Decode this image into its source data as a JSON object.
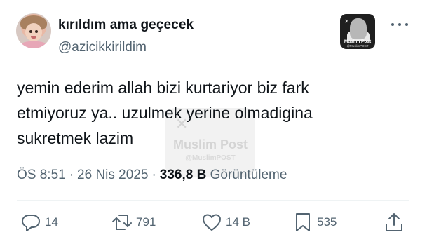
{
  "author": {
    "display_name": "kırıldım ama geçecek",
    "handle": "@azicikkirildim"
  },
  "badge": {
    "title": "Muslim Post",
    "subtitle": "@MuslimPOST"
  },
  "watermark": {
    "title": "Muslim Post",
    "subtitle": "@MuslimPOST"
  },
  "tweet": {
    "lines": [
      "yemin ederim allah bizi kurtariyor biz fark",
      "etmiyoruz ya.. uzulmek yerine olmadigina",
      "sukretmek lazim"
    ]
  },
  "meta": {
    "time": "ÖS 8:51",
    "date": "26 Nis 2025",
    "views_count": "336,8 B",
    "views_label": "Görüntüleme",
    "separator": "·"
  },
  "actions": {
    "replies": "14",
    "reposts": "791",
    "likes": "14 B",
    "bookmarks": "535"
  },
  "icons": {
    "reply": "speech-bubble-icon",
    "repost": "repost-arrows-icon",
    "like": "heart-icon",
    "bookmark": "bookmark-icon",
    "share": "share-icon",
    "more": "more-horizontal-icon"
  },
  "colors": {
    "text_primary": "#0f1419",
    "text_secondary": "#536471",
    "divider": "#eff3f4",
    "background": "#ffffff"
  }
}
